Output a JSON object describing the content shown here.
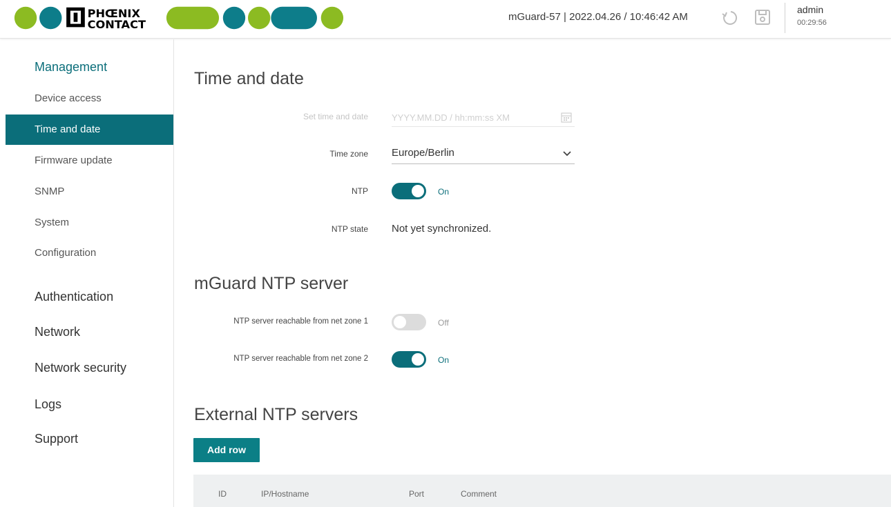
{
  "header": {
    "brand": "PHOENIX CONTACT",
    "device_info": "mGuard-57 | 2022.04.26 / 10:46:42 AM",
    "user": "admin",
    "session_timer": "00:29:56",
    "icons": [
      "undo-icon",
      "save-icon"
    ]
  },
  "colors": {
    "accent": "#0b6e7a",
    "button": "#0b7f86",
    "logo_blue": "#0d7d8a",
    "logo_green": "#8cbb22",
    "logo_black": "#000000"
  },
  "sidebar": {
    "management": "Management",
    "items": [
      {
        "label": "Device access"
      },
      {
        "label": "Time and date",
        "selected": true
      },
      {
        "label": "Firmware update"
      },
      {
        "label": "SNMP"
      },
      {
        "label": "System"
      },
      {
        "label": "Configuration"
      }
    ],
    "sections": [
      "Authentication",
      "Network",
      "Network security",
      "Logs",
      "Support"
    ]
  },
  "time_date": {
    "title": "Time and date",
    "set_label": "Set time and date",
    "set_placeholder": "YYYY.MM.DD / hh:mm:ss XM",
    "tz_label": "Time zone",
    "tz_value": "Europe/Berlin",
    "ntp_label": "NTP",
    "ntp_state_text": "On",
    "ntp_status_label": "NTP state",
    "ntp_status_value": "Not yet synchronized."
  },
  "ntp_server": {
    "title": "mGuard NTP server",
    "zone1_label": "NTP server reachable from net zone 1",
    "zone1_state": "Off",
    "zone2_label": "NTP server reachable from net zone 2",
    "zone2_state": "On"
  },
  "external": {
    "title": "External NTP servers",
    "add_row": "Add row",
    "columns": [
      "ID",
      "IP/Hostname",
      "Port",
      "Comment"
    ]
  }
}
